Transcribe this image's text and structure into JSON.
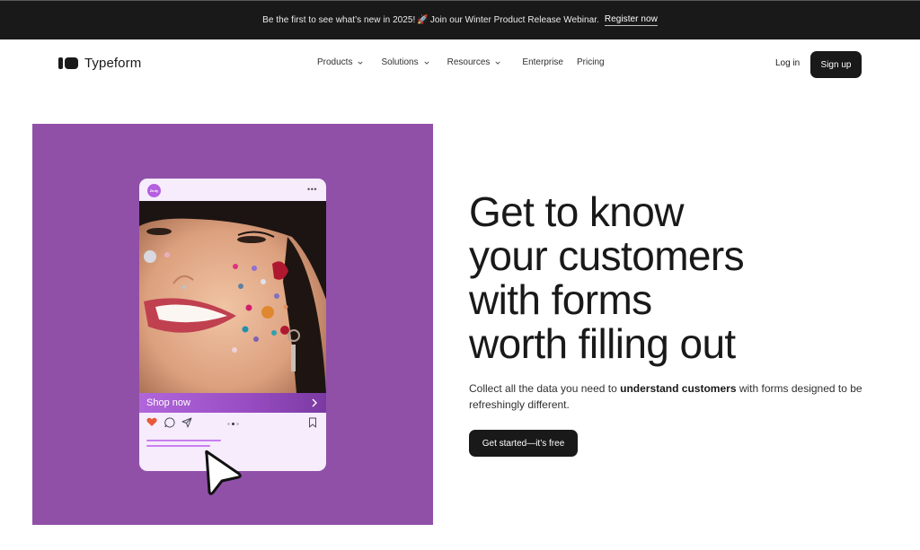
{
  "announcement": {
    "message": "Be the first to see what’s new in 2025!",
    "emoji": "🚀",
    "message_after": "Join our Winter Product Release Webinar.",
    "link_label": "Register now"
  },
  "header": {
    "logo_text": "Typeform",
    "nav": [
      {
        "label": "Products",
        "has_dropdown": true
      },
      {
        "label": "Solutions",
        "has_dropdown": true
      },
      {
        "label": "Resources",
        "has_dropdown": true
      },
      {
        "label": "Enterprise",
        "has_dropdown": false
      },
      {
        "label": "Pricing",
        "has_dropdown": false
      }
    ],
    "login_label": "Log in",
    "signup_label": "Sign up"
  },
  "hero": {
    "headline_lines": [
      "Get to know",
      "your customers",
      "with forms",
      "worth filling out"
    ],
    "subtext_before": "Collect all the data you need to ",
    "subtext_bold": "understand customers",
    "subtext_after": " with forms designed to be refreshingly different.",
    "cta_label": "Get started—it’s free",
    "panel_color": "#9050a8"
  },
  "social_card": {
    "avatar_text": "Zinty",
    "more_icon": "ellipsis-icon",
    "shop_label": "Shop now",
    "actions": [
      "heart-icon",
      "comment-icon",
      "send-icon",
      "bookmark-icon"
    ],
    "carousel": {
      "count": 3,
      "active_index": 1
    }
  }
}
